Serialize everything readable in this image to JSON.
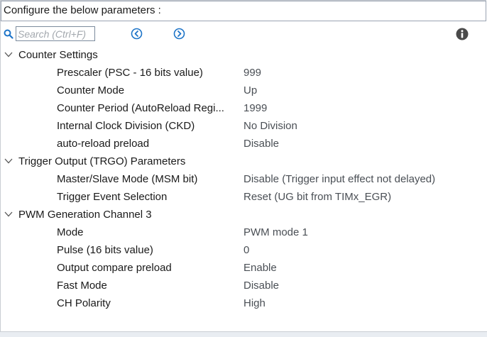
{
  "header": {
    "title": "Configure the below parameters :"
  },
  "toolbar": {
    "search_placeholder": "Search (Ctrl+F)",
    "icons": {
      "search": "search-icon",
      "prev": "arrow-left-circle-icon",
      "next": "arrow-right-circle-icon",
      "info": "info-icon"
    }
  },
  "colors": {
    "accent": "#1d74c8",
    "info": "#4a4a4a"
  },
  "sections": [
    {
      "label": "Counter Settings",
      "expanded": true,
      "params": [
        {
          "label": "Prescaler (PSC - 16 bits value)",
          "value": "999"
        },
        {
          "label": "Counter Mode",
          "value": "Up"
        },
        {
          "label": "Counter Period (AutoReload Regi...",
          "value": "1999"
        },
        {
          "label": "Internal Clock Division (CKD)",
          "value": "No Division"
        },
        {
          "label": "auto-reload preload",
          "value": "Disable"
        }
      ]
    },
    {
      "label": "Trigger Output (TRGO) Parameters",
      "expanded": true,
      "params": [
        {
          "label": "Master/Slave Mode (MSM bit)",
          "value": "Disable (Trigger input effect not delayed)"
        },
        {
          "label": "Trigger Event Selection",
          "value": "Reset (UG bit from TIMx_EGR)"
        }
      ]
    },
    {
      "label": "PWM Generation Channel 3",
      "expanded": true,
      "params": [
        {
          "label": "Mode",
          "value": "PWM mode 1"
        },
        {
          "label": "Pulse (16 bits value)",
          "value": "0"
        },
        {
          "label": "Output compare preload",
          "value": "Enable"
        },
        {
          "label": "Fast Mode",
          "value": "Disable"
        },
        {
          "label": "CH Polarity",
          "value": "High"
        }
      ]
    }
  ]
}
